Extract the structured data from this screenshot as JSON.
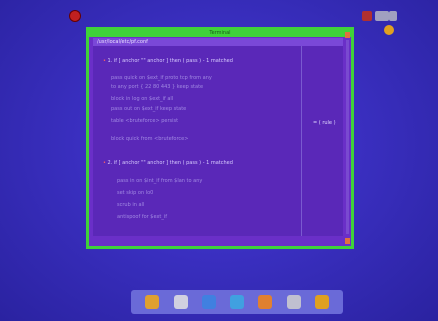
{
  "window": {
    "title": "Terminal",
    "header": "/usr/local/etc/pf.conf"
  },
  "code_blocks": [
    {
      "header": "1. if [ anchor \"\" anchor ] then ( pass ) - 1 matched",
      "lines": [
        "pass quick on $ext_if proto tcp from any",
        "to any port { 22 80 443 } keep state",
        "block in log on $ext_if all",
        "pass out on $ext_if keep state",
        "table <bruteforce> persist",
        "block quick from <bruteforce>"
      ]
    },
    {
      "header": "2. if [ anchor \"\" anchor ] then ( pass ) - 1 matched",
      "lines": [
        "pass in on $int_if from $lan to any",
        "set skip on lo0",
        "scrub in all",
        "antispoof for $ext_if"
      ]
    }
  ],
  "side_note": "= ( rule )",
  "colors": {
    "window_border": "#3fd23a",
    "window_bg": "#6a2fc8",
    "desktop": "#3a2fc0",
    "accent": "#e07040"
  },
  "dock_icons": [
    {
      "name": "home-icon",
      "color": "#e0a030"
    },
    {
      "name": "browser-icon",
      "color": "#d0d0e0"
    },
    {
      "name": "files-icon",
      "color": "#4080e0"
    },
    {
      "name": "terminal-icon",
      "color": "#40a0e0"
    },
    {
      "name": "settings-icon",
      "color": "#e08030"
    },
    {
      "name": "trash-icon",
      "color": "#c0c0d0"
    },
    {
      "name": "mail-icon",
      "color": "#e0a020"
    }
  ]
}
